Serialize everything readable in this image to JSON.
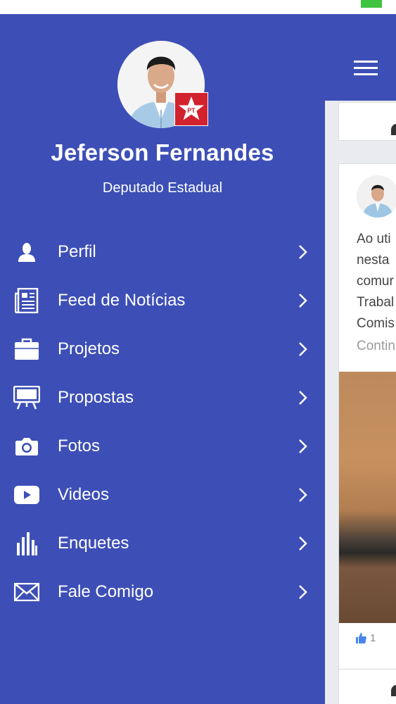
{
  "profile": {
    "name": "Jeferson Fernandes",
    "role": "Deputado Estadual",
    "party_badge_text": "PT"
  },
  "menu": {
    "items": [
      {
        "label": "Perfil",
        "icon": "person-icon"
      },
      {
        "label": "Feed de Notícias",
        "icon": "newspaper-icon"
      },
      {
        "label": "Projetos",
        "icon": "briefcase-icon"
      },
      {
        "label": "Propostas",
        "icon": "easel-icon"
      },
      {
        "label": "Fotos",
        "icon": "camera-icon"
      },
      {
        "label": "Videos",
        "icon": "play-icon"
      },
      {
        "label": "Enquetes",
        "icon": "bar-chart-icon"
      },
      {
        "label": "Fale Comigo",
        "icon": "envelope-icon"
      }
    ]
  },
  "feed": {
    "post_lines": [
      "Ao uti",
      "nesta ",
      "comur",
      "Trabal",
      "Comis"
    ],
    "continue_label": "Contin",
    "likes_count": "1"
  },
  "colors": {
    "primary": "#3d4fb6",
    "badge_red": "#d2222d",
    "battery_green": "#3ec43e"
  }
}
